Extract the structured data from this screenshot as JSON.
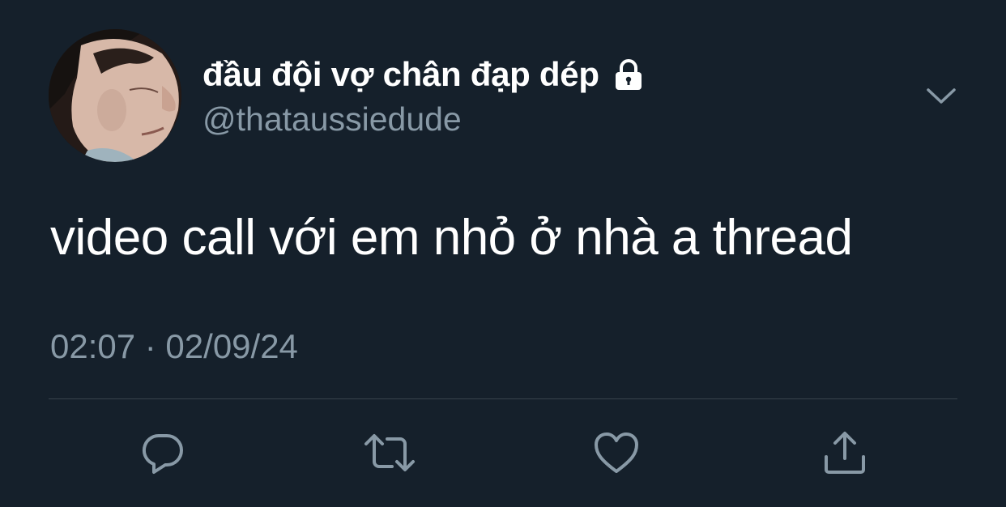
{
  "author": {
    "display_name": "đầu đội vợ chân đạp dép",
    "handle": "@thataussiedude",
    "protected_icon": "lock-icon",
    "avatar": "profile-photo"
  },
  "tweet": {
    "text": "video call với em nhỏ ở nhà a thread",
    "timestamp": "02:07 · 02/09/24"
  },
  "menu_icon": "chevron-down-icon",
  "actions": [
    {
      "name": "reply",
      "icon": "reply-icon"
    },
    {
      "name": "retweet",
      "icon": "retweet-icon"
    },
    {
      "name": "like",
      "icon": "heart-icon"
    },
    {
      "name": "share",
      "icon": "share-icon"
    }
  ],
  "colors": {
    "background": "#15202b",
    "primary_text": "#ffffff",
    "secondary_text": "#8899a6",
    "divider": "#38444d"
  }
}
